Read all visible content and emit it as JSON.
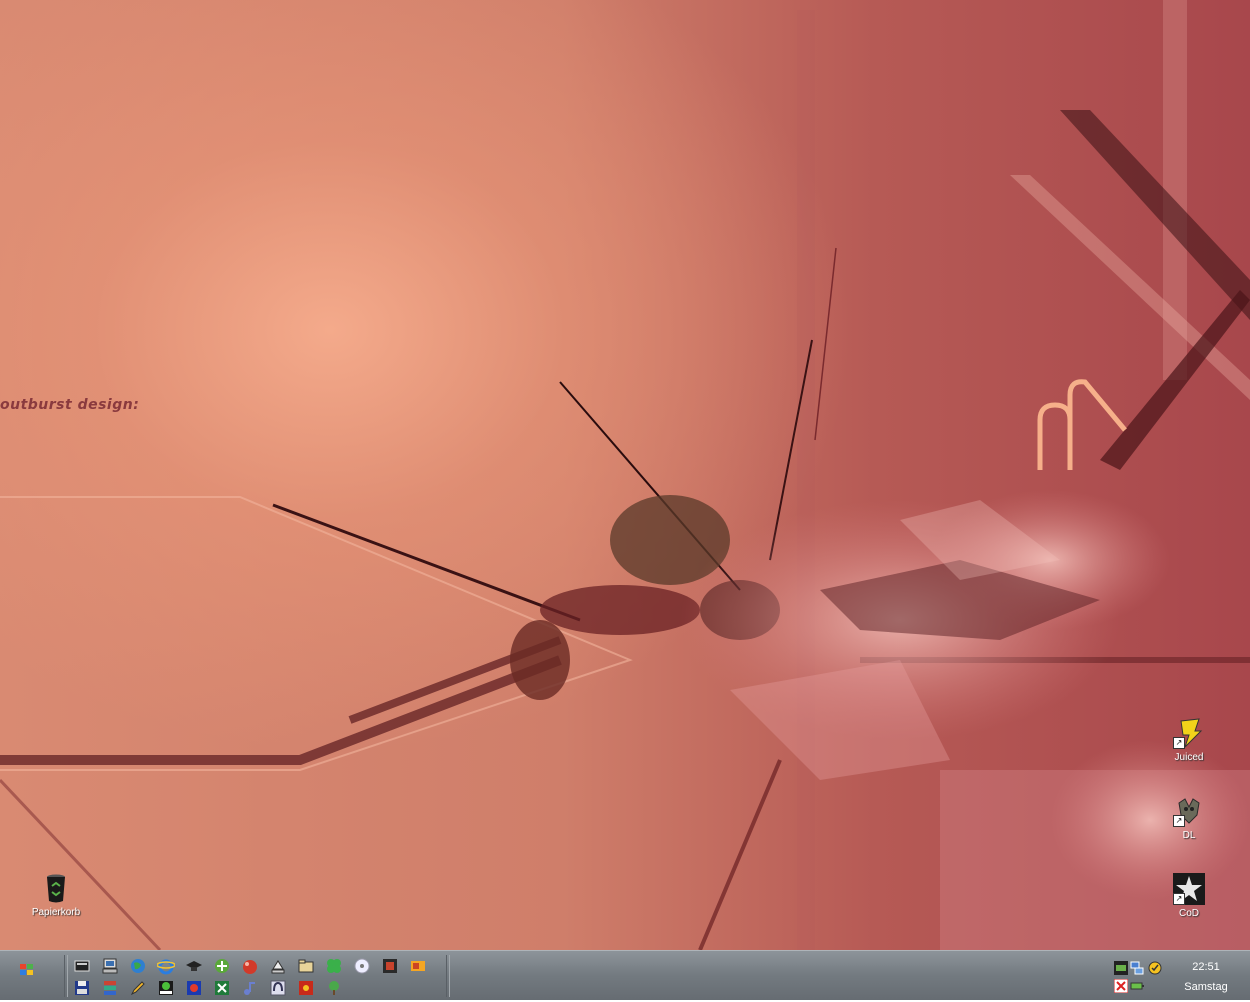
{
  "wallpaper": {
    "brand_text": "outburst design:"
  },
  "desktop_icons": [
    {
      "label": "Papierkorb",
      "icon": "recycle-bin-icon"
    },
    {
      "label": "Juiced",
      "icon": "juiced-game-icon"
    },
    {
      "label": "DL",
      "icon": "dl-game-icon"
    },
    {
      "label": "CoD",
      "icon": "cod-game-icon"
    }
  ],
  "taskbar": {
    "start_icon": "windows-logo-icon",
    "quick_launch": [
      "show-desktop-icon",
      "my-computer-icon",
      "globe-icon",
      "internet-explorer-icon",
      "graduation-cap-icon",
      "green-plus-icon",
      "red-orb-icon",
      "eject-icon",
      "folder-icon",
      "clover-icon",
      "cd-icon",
      "media-player-icon",
      "paint-icon",
      "floppy-disk-icon",
      "archive-icon",
      "pencil-icon",
      "pro-app-icon",
      "game-app-icon",
      "excel-icon",
      "music-note-icon",
      "headphones-icon",
      "red-app-icon",
      "green-tree-icon"
    ],
    "tray": {
      "time": "22:51",
      "day": "Samstag",
      "icons": [
        "nvidia-icon",
        "network-icon",
        "norton-icon",
        "close-red-icon",
        "battery-icon"
      ]
    }
  },
  "colors": {
    "taskbar": "#737a80",
    "wallpaper_accent": "#a8474c"
  }
}
